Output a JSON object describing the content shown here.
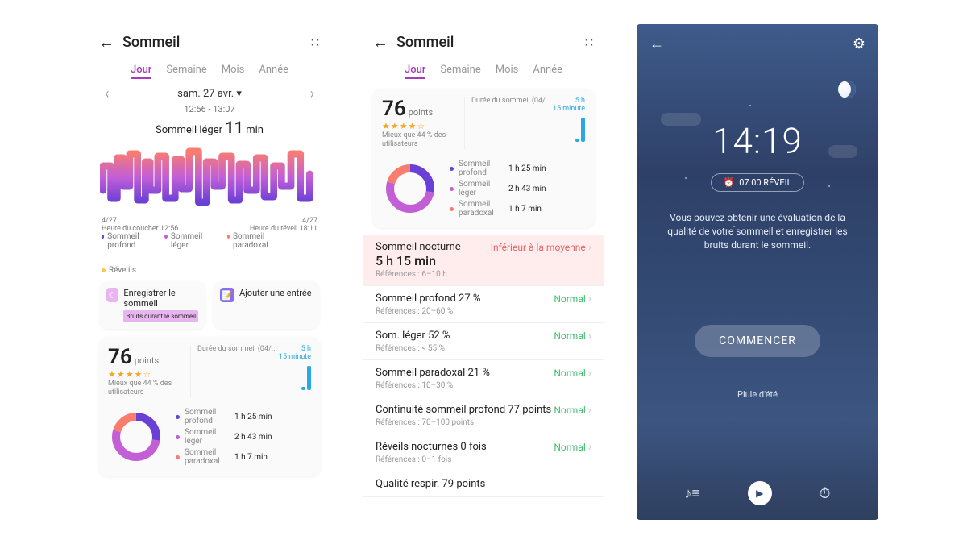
{
  "colors": {
    "deep": "#6a3fd6",
    "light": "#c35fd6",
    "paradox": "#f97d6f",
    "wake": "#f4c94a",
    "blue": "#2aa7e6",
    "green": "#3fbf6f",
    "red": "#e06666"
  },
  "screen1": {
    "title": "Sommeil",
    "tabs": [
      "Jour",
      "Semaine",
      "Mois",
      "Année"
    ],
    "active_tab": "Jour",
    "date": "sam. 27 avr.",
    "time_range": "12:56 - 13:07",
    "light_label": "Sommeil léger",
    "light_value": "11",
    "light_unit": "min",
    "chart_left_date": "4/27",
    "chart_left_label": "Heure du coucher 12:56",
    "chart_right_date": "4/27",
    "chart_right_label": "Heure du réveil 18:11",
    "legend": [
      {
        "label": "Sommeil profond",
        "color": "#6a3fd6"
      },
      {
        "label": "Sommeil léger",
        "color": "#c35fd6"
      },
      {
        "label": "Sommeil paradoxal",
        "color": "#f97d6f"
      },
      {
        "label": "Réve ils",
        "color": "#f4c94a"
      }
    ],
    "action1": {
      "label": "Enregistrer le sommeil",
      "badge": "Bruits durant le sommeil"
    },
    "action2": {
      "label": "Ajouter une entrée"
    }
  },
  "score": {
    "value": "76",
    "unit": "points",
    "stars": "★★★★☆",
    "better": "Mieux que 44 % des utilisateurs",
    "mini_title": "Durée du sommeil (04/...",
    "mini_corner1": "5 h",
    "mini_corner2": "15 minute",
    "breakdown": [
      {
        "label": "Sommeil profond",
        "value": "1 h 25 min",
        "color": "#6a3fd6"
      },
      {
        "label": "Sommeil léger",
        "value": "2 h 43 min",
        "color": "#c35fd6"
      },
      {
        "label": "Sommeil paradoxal",
        "value": "1 h 7 min",
        "color": "#f97d6f"
      }
    ]
  },
  "screen2": {
    "title": "Sommeil",
    "tabs": [
      "Jour",
      "Semaine",
      "Mois",
      "Année"
    ],
    "active_tab": "Jour",
    "metrics": [
      {
        "title": "Sommeil nocturne",
        "value": "5 h 15 min",
        "ref": "Références : 6–10 h",
        "status": "Inférieur à la moyenne",
        "status_kind": "red",
        "pink": true
      },
      {
        "title": "Sommeil profond  27 %",
        "ref": "Références : 20–60 %",
        "status": "Normal",
        "status_kind": "green"
      },
      {
        "title": "Som. léger  52 %",
        "ref": "Références : < 55 %",
        "status": "Normal",
        "status_kind": "green"
      },
      {
        "title": "Sommeil paradoxal  21 %",
        "ref": "Références : 10–30 %",
        "status": "Normal",
        "status_kind": "green"
      },
      {
        "title": "Continuité sommeil profond  77 points",
        "ref": "Références : 70–100 points",
        "status": "Normal",
        "status_kind": "green"
      },
      {
        "title": "Réveils nocturnes  0 fois",
        "ref": "Références : 0–1 fois",
        "status": "Normal",
        "status_kind": "green"
      },
      {
        "title": "Qualité respir.  79 points",
        "ref": "",
        "status": "",
        "status_kind": "green"
      }
    ]
  },
  "screen3": {
    "time": "14:19",
    "alarm": "07:00 RÉVEIL",
    "desc": "Vous pouvez obtenir une évaluation de la qualité de votre sommeil et enregistrer les bruits durant le sommeil.",
    "start": "COMMENCER",
    "sound": "Pluie d'été"
  }
}
